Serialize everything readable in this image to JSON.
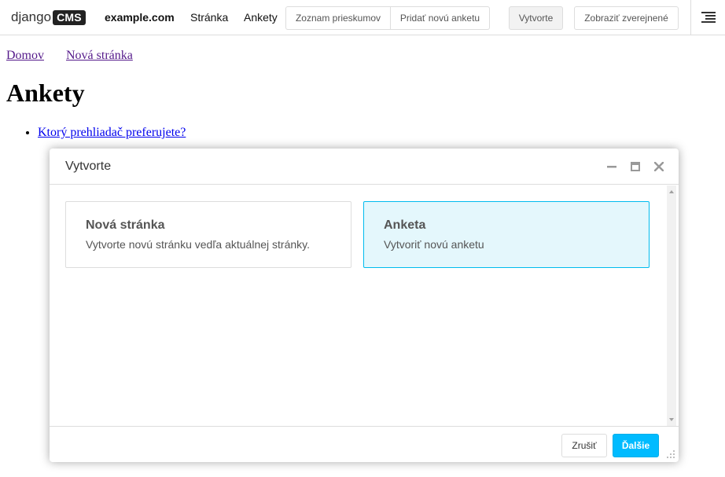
{
  "toolbar": {
    "logo_text": "django",
    "logo_badge": "CMS",
    "site": "example.com",
    "menu_page": "Stránka",
    "menu_polls": "Ankety",
    "btn_poll_list": "Zoznam prieskumov",
    "btn_add_poll": "Pridať novú anketu",
    "btn_create": "Vytvorte",
    "btn_view_published": "Zobraziť zverejnené",
    "menu_icon": "hamburger-icon"
  },
  "page": {
    "breadcrumb": [
      "Domov",
      "Nová stránka"
    ],
    "title": "Ankety",
    "polls": [
      "Ktorý prehliadač preferujete?"
    ]
  },
  "modal": {
    "title": "Vytvorte",
    "controls": [
      "minimize-icon",
      "maximize-icon",
      "close-icon"
    ],
    "options": [
      {
        "title": "Nová stránka",
        "description": "Vytvorte novú stránku vedľa aktuálnej stránky.",
        "selected": false
      },
      {
        "title": "Anketa",
        "description": "Vytvoriť novú anketu",
        "selected": true
      }
    ],
    "cancel_label": "Zrušiť",
    "next_label": "Ďalšie"
  },
  "colors": {
    "accent": "#00bbff",
    "selected_bg": "#e4f7fc",
    "selected_border": "#00bbee",
    "visited_link": "#551a8b",
    "link": "#0000ee"
  }
}
